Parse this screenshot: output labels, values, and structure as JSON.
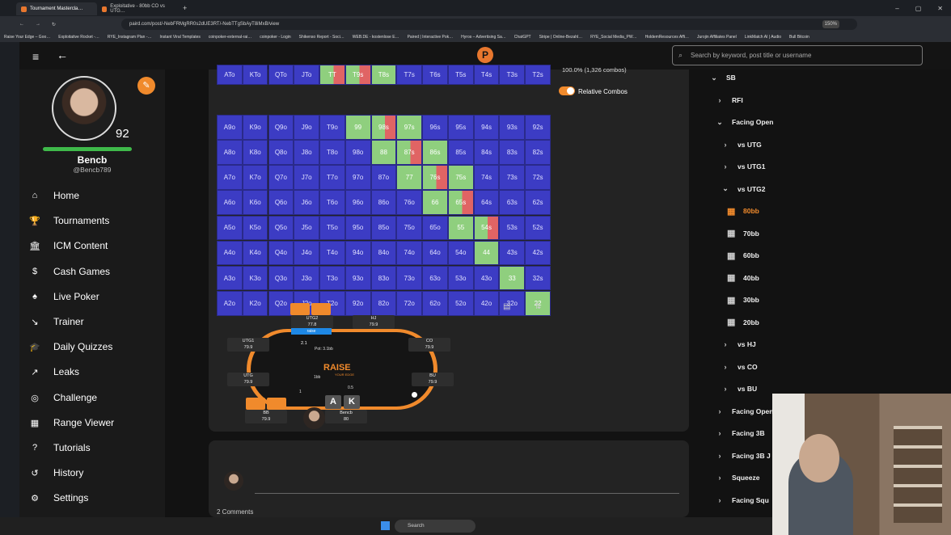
{
  "browser": {
    "tabs": [
      "Tournament Mastercla…",
      "Exploitative - 80bb CO vs UTG…"
    ],
    "url": "paird.com/post/-NebFRMgRR0s2dUE3RT/-NebTTgSbAyT8iMxB/view",
    "zoom": "150%",
    "bookmarks": [
      "Raise Your Edge – Goo…",
      "Exploitative Rocket -…",
      "RYE_Instagram Plan -…",
      "Instant Viral Templates",
      "coinpoker-external-rai…",
      "coinpoker - Login",
      "Shikenso Report - Soci…",
      "WEB.DE - kostenlose E…",
      "Paired | Interactive Pok…",
      "Hyros – Advertising Sa…",
      "ChatGPT",
      "Stripe | Online-Bezahl…",
      "RYE_Social Media_PW…",
      "HoldemResources Affi…",
      "Jurojin Affiliates Panel",
      "LinkMatch AI | Audio",
      "Bull Bitcoin"
    ]
  },
  "header": {
    "search_placeholder": "Search by keyword, post title or username"
  },
  "profile": {
    "level": "92",
    "name": "Bencb",
    "handle": "@Bencb789"
  },
  "nav": [
    {
      "label": "Home",
      "icon": "⌂"
    },
    {
      "label": "Tournaments",
      "icon": "🏆"
    },
    {
      "label": "ICM Content",
      "icon": "🏛"
    },
    {
      "label": "Cash Games",
      "icon": "$"
    },
    {
      "label": "Live Poker",
      "icon": "♠"
    },
    {
      "label": "Trainer",
      "icon": "↘"
    },
    {
      "label": "Daily Quizzes",
      "icon": "🎓"
    },
    {
      "label": "Leaks",
      "icon": "↗"
    },
    {
      "label": "Challenge",
      "icon": "◎"
    },
    {
      "label": "Range Viewer",
      "icon": "▦"
    },
    {
      "label": "Tutorials",
      "icon": "?"
    },
    {
      "label": "History",
      "icon": "↺"
    },
    {
      "label": "Settings",
      "icon": "⚙"
    }
  ],
  "range": {
    "combos_label": "100.0% (1,326 combos)",
    "relative_label": "Relative Combos",
    "rows": [
      [
        "A7o",
        "K7o",
        "Q7o",
        "J7o",
        "T7o",
        "97o",
        "87o",
        "77",
        "76s",
        "75s",
        "74s",
        "73s",
        "72s"
      ],
      [
        "A9o",
        "K9o",
        "Q9o",
        "J9o",
        "T9o",
        "99",
        "98s",
        "97s",
        "96s",
        "95s",
        "94s",
        "93s",
        "92s"
      ],
      [
        "A8o",
        "K8o",
        "Q8o",
        "J8o",
        "T8o",
        "98o",
        "88",
        "87s",
        "86s",
        "85s",
        "84s",
        "83s",
        "82s"
      ],
      [
        "A7o",
        "K7o",
        "Q7o",
        "J7o",
        "T7o",
        "97o",
        "87o",
        "77",
        "76s",
        "75s",
        "74s",
        "73s",
        "72s"
      ],
      [
        "A6o",
        "K6o",
        "Q6o",
        "J6o",
        "T6o",
        "96o",
        "86o",
        "76o",
        "66",
        "65s",
        "64s",
        "63s",
        "62s"
      ],
      [
        "A5o",
        "K5o",
        "Q5o",
        "J5o",
        "T5o",
        "95o",
        "85o",
        "75o",
        "65o",
        "55",
        "54s",
        "53s",
        "52s"
      ],
      [
        "A4o",
        "K4o",
        "Q4o",
        "J4o",
        "T4o",
        "94o",
        "84o",
        "74o",
        "64o",
        "54o",
        "44",
        "43s",
        "42s"
      ],
      [
        "A3o",
        "K3o",
        "Q3o",
        "J3o",
        "T3o",
        "93o",
        "83o",
        "73o",
        "63o",
        "53o",
        "43o",
        "33",
        "32s"
      ],
      [
        "A2o",
        "K2o",
        "Q2o",
        "J2o",
        "T2o",
        "92o",
        "82o",
        "72o",
        "62o",
        "52o",
        "42o",
        "32o",
        "22"
      ]
    ],
    "top_row": [
      "ATo",
      "KTo",
      "QTo",
      "JTo",
      "TT",
      "T9s",
      "T8s",
      "T7s",
      "T6s",
      "T5s",
      "T4s",
      "T3s",
      "T2s"
    ]
  },
  "table": {
    "seats": [
      {
        "pos": "UTG2",
        "stack": "77.8"
      },
      {
        "pos": "HJ",
        "stack": "79.9"
      },
      {
        "pos": "UTG1",
        "stack": "79.9"
      },
      {
        "pos": "CO",
        "stack": "79.9"
      },
      {
        "pos": "UTG",
        "stack": "79.9"
      },
      {
        "pos": "BU",
        "stack": "79.9"
      },
      {
        "pos": "BB",
        "stack": "79.9"
      },
      {
        "pos": "Bencb",
        "stack": "80"
      }
    ],
    "raise_tag": "raise",
    "bet": "2.1",
    "pot": "Pot: 3.1bb",
    "blind_bb": "1bb",
    "blind_sb": "0.5",
    "bb_chip": "1",
    "hero_cards": [
      "A",
      "K"
    ],
    "logo": "RAISE",
    "logo_sub": "YOUR EDGE"
  },
  "comments": {
    "count_label": "2 Comments"
  },
  "tree": [
    {
      "label": "SB",
      "indent": 0,
      "open": true
    },
    {
      "label": "RFI",
      "indent": 1,
      "open": false
    },
    {
      "label": "Facing Open",
      "indent": 1,
      "open": true
    },
    {
      "label": "vs UTG",
      "indent": 2,
      "open": false
    },
    {
      "label": "vs UTG1",
      "indent": 2,
      "open": false
    },
    {
      "label": "vs UTG2",
      "indent": 2,
      "open": true
    },
    {
      "label": "80bb",
      "indent": 3,
      "leaf": true,
      "active": true
    },
    {
      "label": "70bb",
      "indent": 3,
      "leaf": true
    },
    {
      "label": "60bb",
      "indent": 3,
      "leaf": true
    },
    {
      "label": "40bb",
      "indent": 3,
      "leaf": true
    },
    {
      "label": "30bb",
      "indent": 3,
      "leaf": true
    },
    {
      "label": "20bb",
      "indent": 3,
      "leaf": true
    },
    {
      "label": "vs HJ",
      "indent": 2,
      "open": false
    },
    {
      "label": "vs CO",
      "indent": 2,
      "open": false
    },
    {
      "label": "vs BU",
      "indent": 2,
      "open": false
    },
    {
      "label": "Facing Open",
      "indent": 1,
      "open": false
    },
    {
      "label": "Facing 3B",
      "indent": 1,
      "open": false
    },
    {
      "label": "Facing 3B J",
      "indent": 1,
      "open": false
    },
    {
      "label": "Squeeze",
      "indent": 1,
      "open": false
    },
    {
      "label": "Facing Squ",
      "indent": 1,
      "open": false
    }
  ],
  "taskbar": {
    "search": "Search"
  },
  "colors": {
    "accent": "#f08a2c",
    "grid_blue": "#3c3cc4",
    "grid_green": "#8fcf7e",
    "grid_red": "#e06464",
    "profile_bar": "#3fb94a"
  }
}
